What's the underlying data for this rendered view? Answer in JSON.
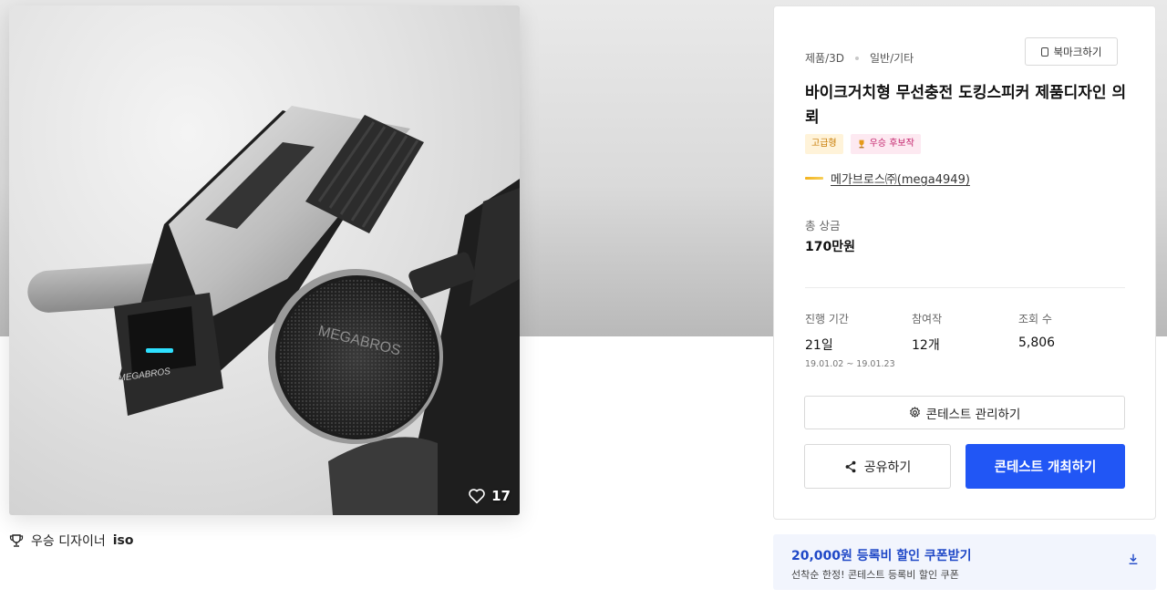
{
  "colors": {
    "primary": "#2156f5",
    "coupon_text": "#1f48c7",
    "premium_tag_bg": "#fff3d9",
    "premium_tag_text": "#c77a00",
    "candidate_tag_bg": "#fde9f1",
    "candidate_tag_text": "#c3226c"
  },
  "artwork": {
    "brand_text": "MEGABROS",
    "likes": "17",
    "winner_label": "우승 디자이너",
    "winner_name": "iso"
  },
  "contest": {
    "category": "제품/3D",
    "subcategory": "일반/기타",
    "bookmark_label": "북마크하기",
    "title": "바이크거치형 무선충전 도킹스피커 제품디자인 의뢰",
    "tags": {
      "premium": "고급형",
      "candidate": "우승 후보작"
    },
    "host_name": "메가브로스㈜(mega4949)",
    "prize_label": "총 상금",
    "prize_value": "170만원",
    "stats": {
      "period_label": "진행 기간",
      "period_value": "21일",
      "period_range": "19.01.02 ~ 19.01.23",
      "entries_label": "참여작",
      "entries_value": "12개",
      "views_label": "조회 수",
      "views_value": "5,806"
    },
    "manage_label": "콘테스트 관리하기",
    "share_label": "공유하기",
    "host_contest_label": "콘테스트 개최하기"
  },
  "coupon": {
    "headline": "20,000원 등록비 할인 쿠폰받기",
    "subtext": "선착순 한정! 콘테스트 등록비 할인 쿠폰"
  }
}
